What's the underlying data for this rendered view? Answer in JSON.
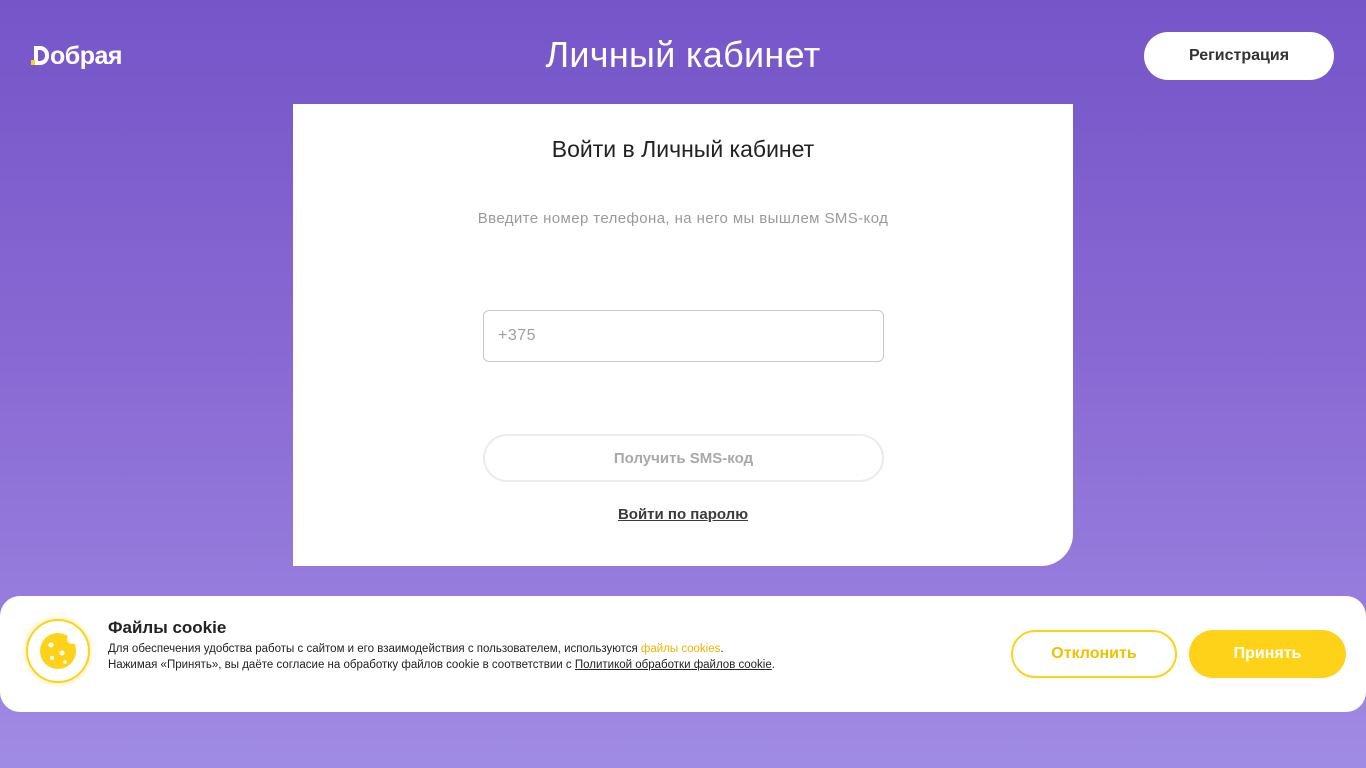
{
  "header": {
    "logo_text": "обрая",
    "page_title": "Личный кабинет",
    "register_label": "Регистрация"
  },
  "login_card": {
    "title": "Войти в Личный кабинет",
    "subtitle": "Введите номер телефона, на него мы вышлем SMS-код",
    "phone_placeholder": "+375",
    "sms_button_label": "Получить SMS-код",
    "password_link_label": "Войти по паролю"
  },
  "cookie_banner": {
    "icon": "cookie-icon",
    "title": "Файлы cookie",
    "line1_before": "Для обеспечения удобства работы с сайтом и его взаимодействия с пользователем, используются ",
    "line1_link": "файлы cookies",
    "line1_after": ".",
    "line2_before": "Нажимая «Принять», вы даёте согласие на обработку файлов cookie в соответствии с ",
    "line2_link": "Политикой обработки файлов cookie",
    "line2_after": ".",
    "decline_label": "Отклонить",
    "accept_label": "Принять"
  },
  "colors": {
    "background_top": "#7555c8",
    "background_bottom": "#a08be4",
    "accent_yellow": "#ffd21a"
  }
}
